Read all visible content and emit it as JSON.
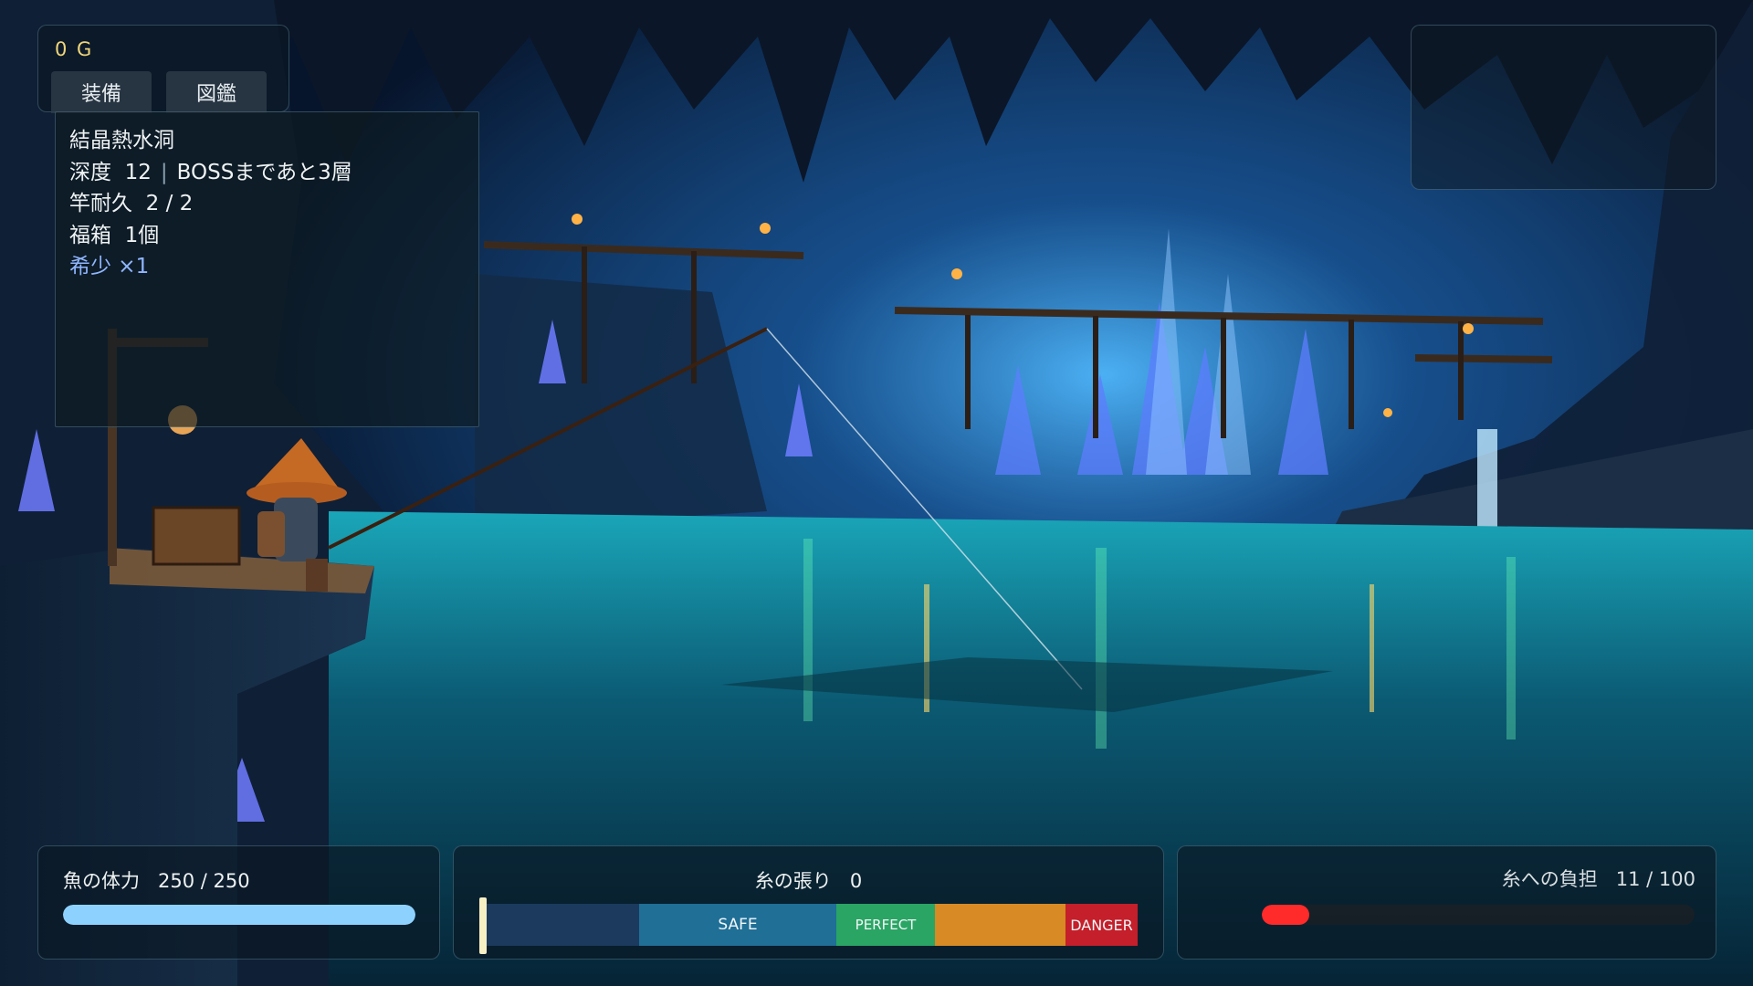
{
  "hud": {
    "gold": "0 G",
    "tabs": [
      {
        "label": "装備"
      },
      {
        "label": "図鑑"
      }
    ]
  },
  "info": {
    "location": "結晶熱水洞",
    "depth_label": "深度",
    "depth_value": "12",
    "separator": "|",
    "boss_text": "BOSSまであと3層",
    "rod_label": "竿耐久",
    "rod_value": "2 / 2",
    "chest_label": "福箱",
    "chest_value": "1個",
    "rare_text": "希少 ×1"
  },
  "fish_stamina": {
    "label": "魚の体力",
    "current": 250,
    "max": 250,
    "text": "250 / 250",
    "fill_color": "#8dd2ff"
  },
  "tension": {
    "label": "糸の張り",
    "value": "0",
    "marker_level": 0,
    "zones": [
      {
        "key": "low",
        "label": "",
        "color": "#1c3a5e"
      },
      {
        "key": "safe",
        "label": "SAFE",
        "color": "#1f6f97"
      },
      {
        "key": "perfect",
        "label": "PERFECT",
        "color": "#2aa564"
      },
      {
        "key": "high",
        "label": "",
        "color": "#d88a24"
      },
      {
        "key": "danger",
        "label": "DANGER",
        "color": "#c41f2a"
      }
    ]
  },
  "line_load": {
    "label": "糸への負担",
    "current": 11,
    "max": 100,
    "text": "11 / 100",
    "fill_color": "#ff2a2a"
  }
}
